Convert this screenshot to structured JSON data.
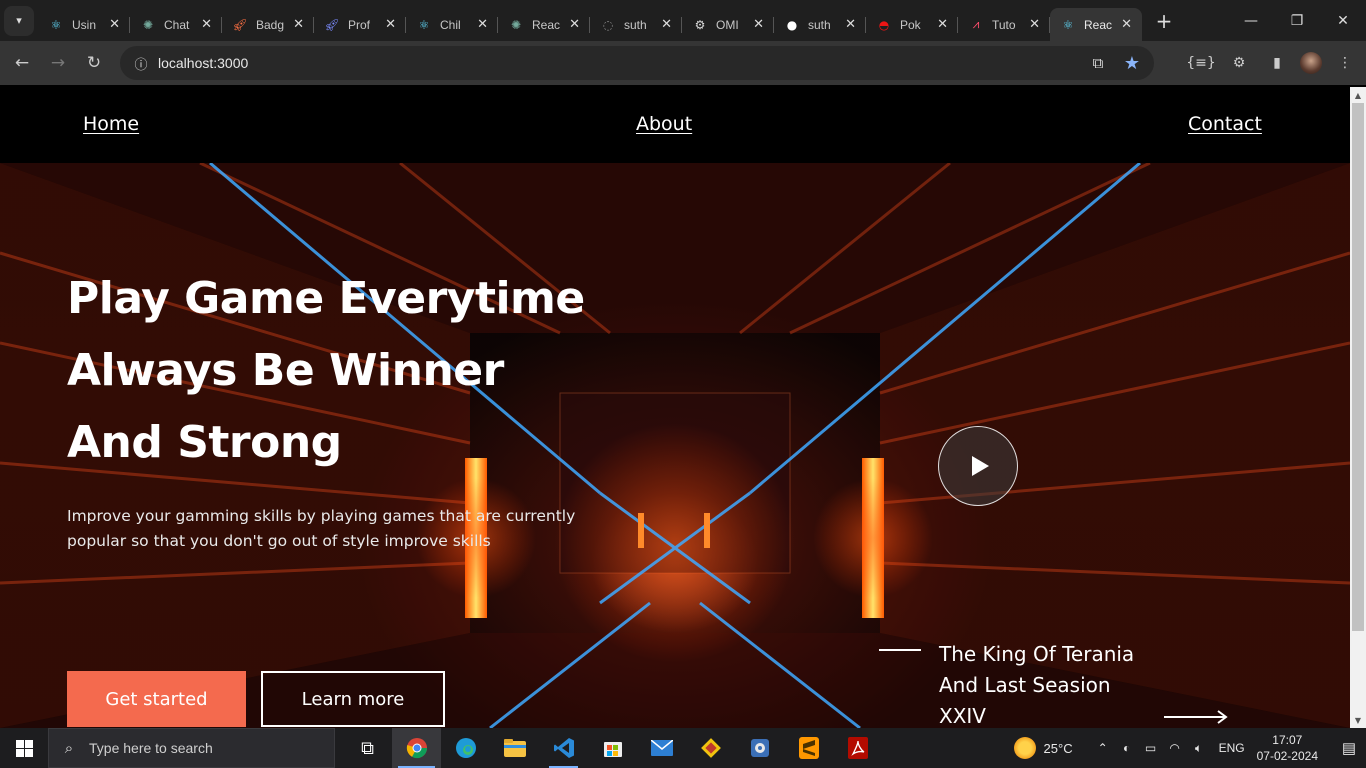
{
  "browser": {
    "tabs": [
      {
        "title": "Usin",
        "icon": "react-icon",
        "color": "#61dafb"
      },
      {
        "title": "Chat",
        "icon": "openai-icon",
        "color": "#74aa9c"
      },
      {
        "title": "Badg",
        "icon": "rocket-icon",
        "color": "#ff7043"
      },
      {
        "title": "Prof",
        "icon": "rocket-icon",
        "color": "#7b8cff"
      },
      {
        "title": "Chil",
        "icon": "react-icon",
        "color": "#61dafb"
      },
      {
        "title": "Reac",
        "icon": "openai-icon",
        "color": "#74aa9c"
      },
      {
        "title": "suth",
        "icon": "loading-icon",
        "color": "#888888"
      },
      {
        "title": "OMI",
        "icon": "gear-icon",
        "color": "#dddddd"
      },
      {
        "title": "suth",
        "icon": "github-icon",
        "color": "#ffffff"
      },
      {
        "title": "Pok",
        "icon": "pokeball-icon",
        "color": "#ee1515"
      },
      {
        "title": "Tuto",
        "icon": "chart-icon",
        "color": "#ff4d6d"
      },
      {
        "title": "Reac",
        "icon": "react-icon",
        "color": "#61dafb",
        "active": true
      }
    ],
    "url": "localhost:3000"
  },
  "site": {
    "nav": {
      "home": "Home",
      "about": "About",
      "contact": "Contact"
    },
    "hero": {
      "headline_line1": "Play Game Everytime",
      "headline_line2": "Always Be Winner",
      "headline_line3": "And Strong",
      "subtext_line1": "Improve your gamming skills by playing games that are currently",
      "subtext_line2": "popular so that you don't go out of style improve skills",
      "btn_primary": "Get started",
      "btn_secondary": "Learn more",
      "season_line1": "The King Of Terania",
      "season_line2": "And Last Seasion",
      "season_line3": "XXIV"
    },
    "accent_color": "#f46a4e"
  },
  "taskbar": {
    "search_placeholder": "Type here to search",
    "weather": "25°C",
    "language": "ENG",
    "time": "17:07",
    "date": "07-02-2024"
  }
}
